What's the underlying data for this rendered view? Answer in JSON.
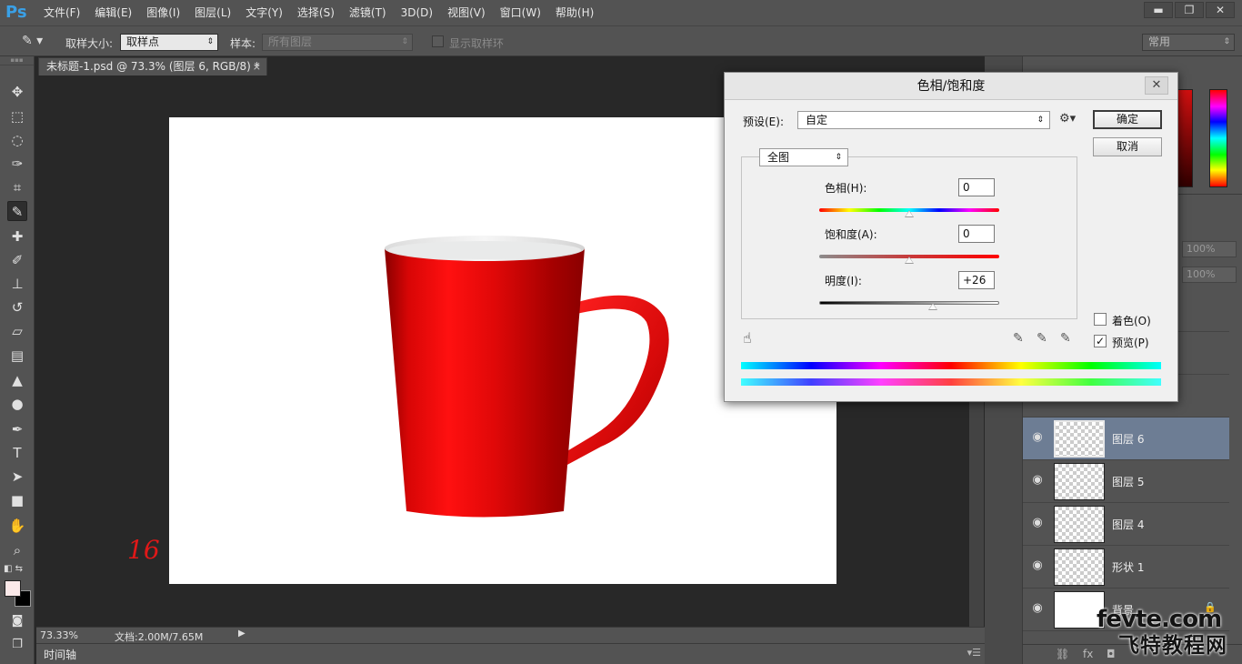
{
  "app": {
    "logo": "Ps"
  },
  "menubar": {
    "items": [
      "文件(F)",
      "编辑(E)",
      "图像(I)",
      "图层(L)",
      "文字(Y)",
      "选择(S)",
      "滤镜(T)",
      "3D(D)",
      "视图(V)",
      "窗口(W)",
      "帮助(H)"
    ],
    "window_controls": {
      "minimize": "▬",
      "restore": "❐",
      "close": "✕"
    }
  },
  "options": {
    "sample_size_label": "取样大小:",
    "sample_size_value": "取样点",
    "sample_label": "样本:",
    "sample_value": "所有图层",
    "show_ring_label": "显示取样环",
    "workspace": "常用"
  },
  "document": {
    "tab_title": "未标题-1.psd @ 73.3% (图层 6, RGB/8) *",
    "tab_close": "×",
    "handwritten_mark": "16"
  },
  "status": {
    "zoom": "73.33%",
    "doc_info": "文档:2.00M/7.65M",
    "timeline_label": "时间轴"
  },
  "layers_panel": {
    "opacity_value": "100%",
    "fill_value": "100%",
    "layers": [
      {
        "name": "图层 6",
        "selected": true,
        "visible": true
      },
      {
        "name": "图层 5",
        "selected": false,
        "visible": true
      },
      {
        "name": "图层 4",
        "selected": false,
        "visible": true
      },
      {
        "name": "形状 1",
        "selected": false,
        "visible": true
      },
      {
        "name": "背景",
        "selected": false,
        "visible": true,
        "locked": true
      }
    ],
    "footer_icons": [
      "link-icon",
      "fx-icon",
      "mask-icon",
      "adjustment-icon",
      "folder-icon",
      "new-layer-icon",
      "trash-icon"
    ]
  },
  "dialog": {
    "title": "色相/饱和度",
    "close": "✕",
    "preset_label": "预设(E):",
    "preset_value": "自定",
    "ok_label": "确定",
    "cancel_label": "取消",
    "channel_value": "全图",
    "hue_label": "色相(H):",
    "hue_value": "0",
    "saturation_label": "饱和度(A):",
    "saturation_value": "0",
    "lightness_label": "明度(I):",
    "lightness_value": "+26",
    "colorize_label": "着色(O)",
    "colorize_checked": false,
    "preview_label": "预览(P)",
    "preview_checked": true,
    "slider_levels": {
      "hue": 0,
      "saturation": 0,
      "lightness": 26
    }
  },
  "watermark": {
    "line1": "fevte.com",
    "line2": "飞特教程网"
  },
  "colors": {
    "foreground": "#fbe9e9",
    "background": "#000000",
    "cup_red": "#e00808",
    "selection_blue": "#6d7d94"
  }
}
